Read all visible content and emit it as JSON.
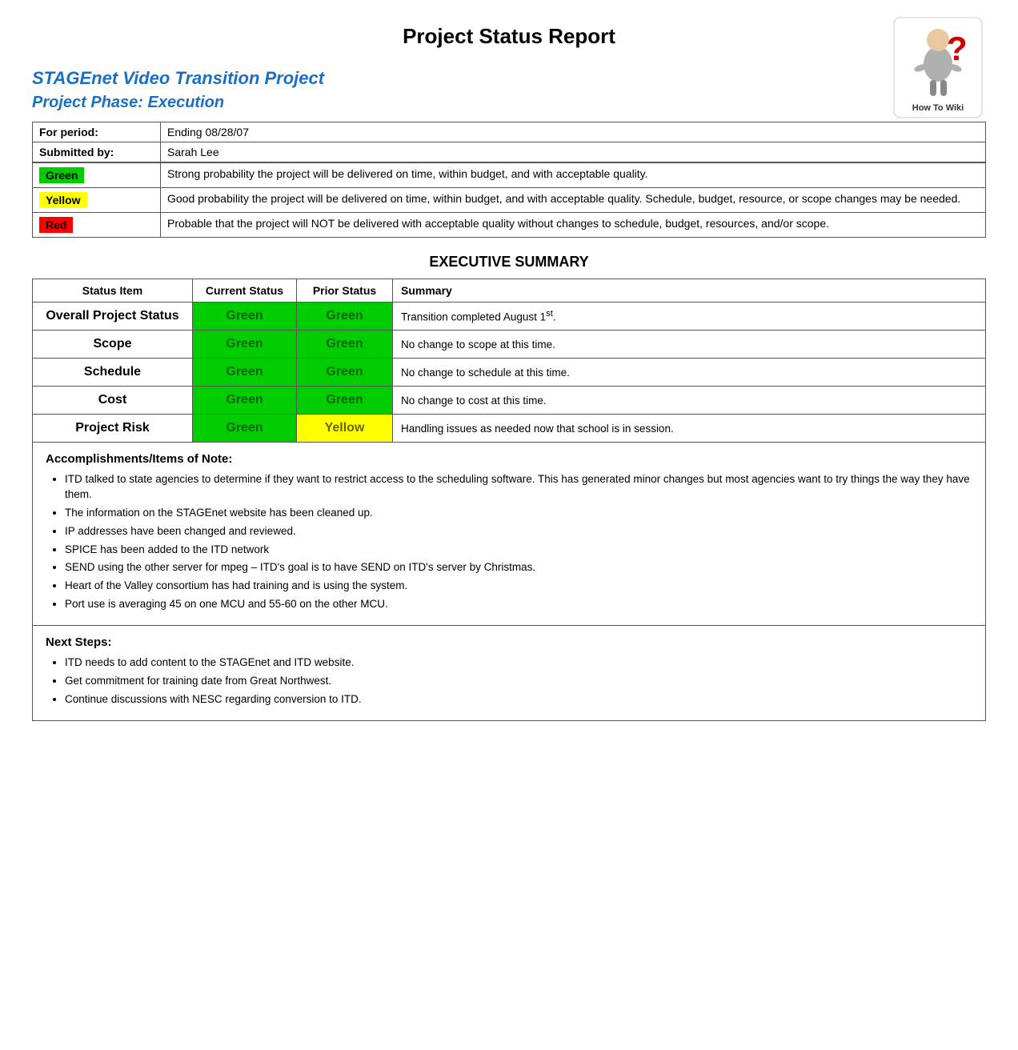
{
  "header": {
    "title": "Project Status Report",
    "logo_text": "How To Wiki"
  },
  "project": {
    "name": "STAGEnet Video Transition Project",
    "phase": "Project Phase: Execution"
  },
  "info": {
    "for_period_label": "For period:",
    "for_period_value": "Ending 08/28/07",
    "submitted_by_label": "Submitted by:",
    "submitted_by_value": "Sarah Lee"
  },
  "legend": {
    "green_label": "Green",
    "green_desc": "Strong probability the project will be delivered on time, within budget, and with acceptable quality.",
    "yellow_label": "Yellow",
    "yellow_desc": "Good probability the project will be delivered on time, within budget, and with acceptable quality. Schedule, budget, resource, or scope changes may be needed.",
    "red_label": "Red",
    "red_desc": "Probable that the project will NOT be delivered with acceptable quality without changes to schedule, budget, resources, and/or scope."
  },
  "executive_summary": {
    "title": "EXECUTIVE SUMMARY",
    "columns": {
      "status_item": "Status Item",
      "current_status": "Current Status",
      "prior_status": "Prior Status",
      "summary": "Summary"
    },
    "rows": [
      {
        "item": "Overall Project Status",
        "current": "Green",
        "prior": "Green",
        "notes": "Transition completed August 1st."
      },
      {
        "item": "Scope",
        "current": "Green",
        "prior": "Green",
        "notes": "No change to scope at this time."
      },
      {
        "item": "Schedule",
        "current": "Green",
        "prior": "Green",
        "notes": "No change to schedule at this time."
      },
      {
        "item": "Cost",
        "current": "Green",
        "prior": "Green",
        "notes": "No change to cost at this time."
      },
      {
        "item": "Project Risk",
        "current": "Green",
        "prior": "Yellow",
        "notes": "Handling issues as needed now that school is in session."
      }
    ]
  },
  "accomplishments": {
    "title": "Accomplishments/Items of Note:",
    "items": [
      "ITD talked to state agencies to determine if they want to restrict access to the scheduling software.  This has generated minor changes but most agencies want to try things the way they have them.",
      "The information on the STAGEnet website has been cleaned up.",
      "IP addresses have been changed and reviewed.",
      "SPICE has been added to the ITD network",
      "SEND using the other server for mpeg – ITD's goal is to have SEND on ITD's server by Christmas.",
      "Heart of the Valley consortium has had training and is using the system.",
      "Port use is averaging 45 on one MCU and 55-60 on the other MCU."
    ]
  },
  "next_steps": {
    "title": "Next Steps:",
    "items": [
      "ITD needs to add content to the STAGEnet and ITD website.",
      "Get commitment for training date from Great Northwest.",
      "Continue discussions with NESC regarding conversion to ITD."
    ]
  }
}
